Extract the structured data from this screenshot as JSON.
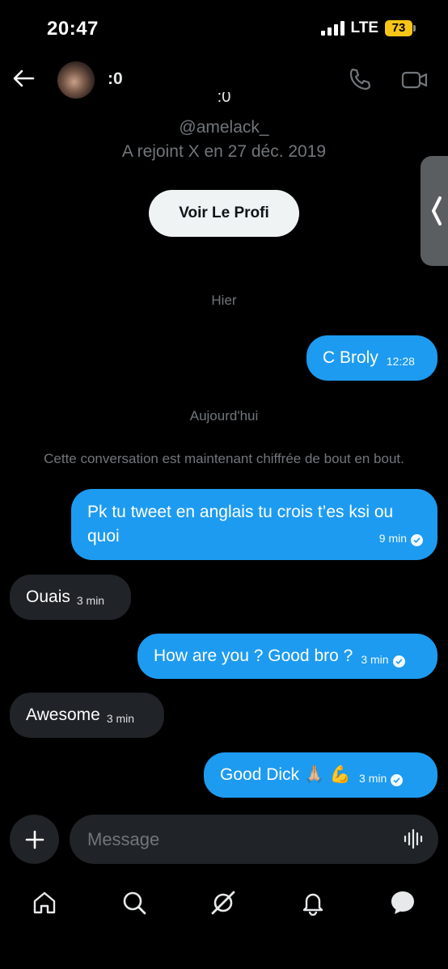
{
  "status_bar": {
    "time": "20:47",
    "network": "LTE",
    "battery": "73"
  },
  "header": {
    "name": ":0"
  },
  "profile": {
    "name_partial": ":0",
    "handle": "@amelack_",
    "joined": "A rejoint X en 27 déc. 2019",
    "view_profile_label": "Voir Le Profi"
  },
  "conversation": {
    "separators": {
      "yesterday": "Hier",
      "today": "Aujourd'hui",
      "encryption": "Cette conversation est maintenant chiffrée de bout en bout."
    },
    "messages": [
      {
        "direction": "outgoing",
        "text": "C Broly",
        "time": "12:28",
        "read": false
      },
      {
        "direction": "outgoing",
        "text": "Pk tu tweet en anglais tu crois t’es ksi ou quoi",
        "time": "9 min",
        "read": true
      },
      {
        "direction": "incoming",
        "text": "Ouais",
        "time": "3 min"
      },
      {
        "direction": "outgoing",
        "text": "How are you ? Good bro ?",
        "time": "3 min",
        "read": true
      },
      {
        "direction": "incoming",
        "text": "Awesome",
        "time": "3 min"
      },
      {
        "direction": "outgoing",
        "text": "Good Dick 🙏🏼 💪",
        "time": "3 min",
        "read": true
      }
    ]
  },
  "composer": {
    "placeholder": "Message"
  },
  "tabs": [
    "home",
    "search",
    "grok",
    "notifications",
    "messages"
  ],
  "icons": {
    "back": "arrow-left-icon",
    "call": "phone-icon",
    "video": "video-camera-icon",
    "add": "plus-icon",
    "voice": "waveform-icon",
    "check": "read-check-icon",
    "side_tab": "chevron-left-icon"
  },
  "colors": {
    "accent": "#1d9bf0",
    "incoming_bubble": "#202327",
    "muted_text": "#71767b",
    "battery": "#f5c518"
  }
}
